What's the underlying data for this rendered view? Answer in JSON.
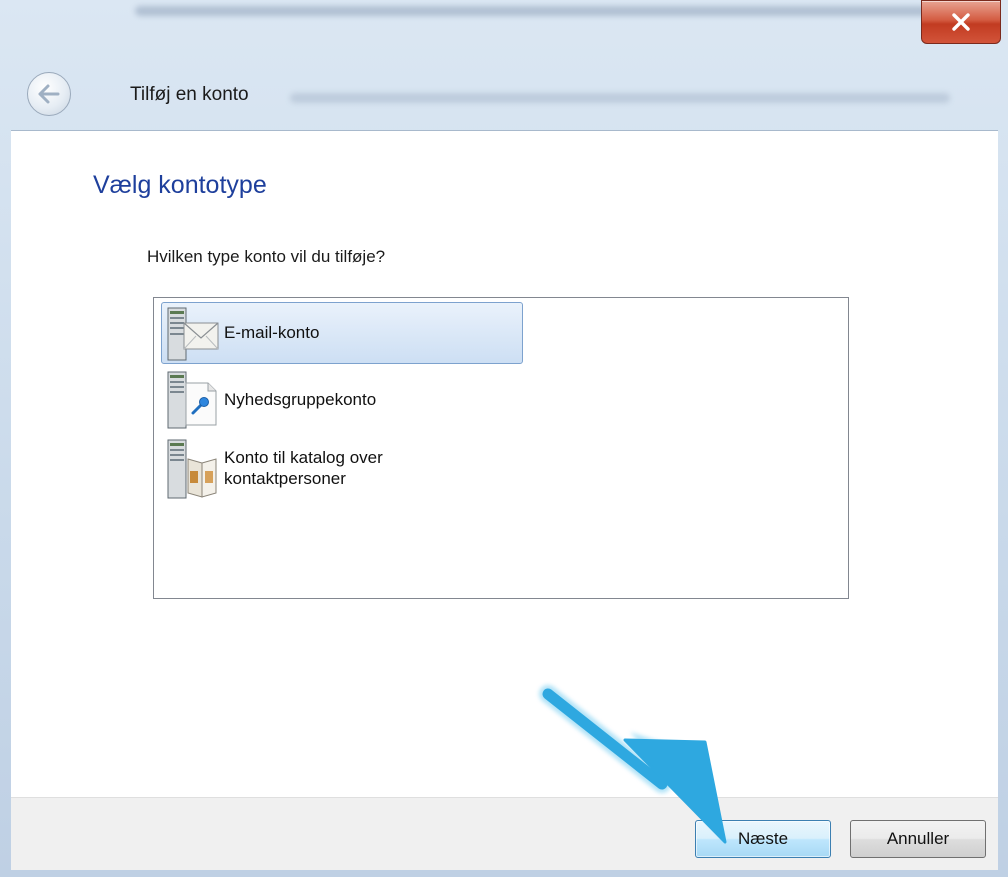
{
  "window": {
    "title": "Tilføj en konto"
  },
  "page": {
    "heading": "Vælg kontotype",
    "question": "Hvilken type konto vil du tilføje?"
  },
  "account_types": [
    {
      "label": "E-mail-konto",
      "icon": "email-server-icon",
      "selected": true
    },
    {
      "label": "Nyhedsgruppekonto",
      "icon": "newsgroup-server-icon",
      "selected": false
    },
    {
      "label": "Konto til katalog over\nkontaktpersoner",
      "icon": "directory-server-icon",
      "selected": false
    }
  ],
  "buttons": {
    "next": "Næste",
    "cancel": "Annuller"
  },
  "colors": {
    "accent_heading": "#1e3f9c",
    "annotation_arrow": "#2ea8e0"
  }
}
